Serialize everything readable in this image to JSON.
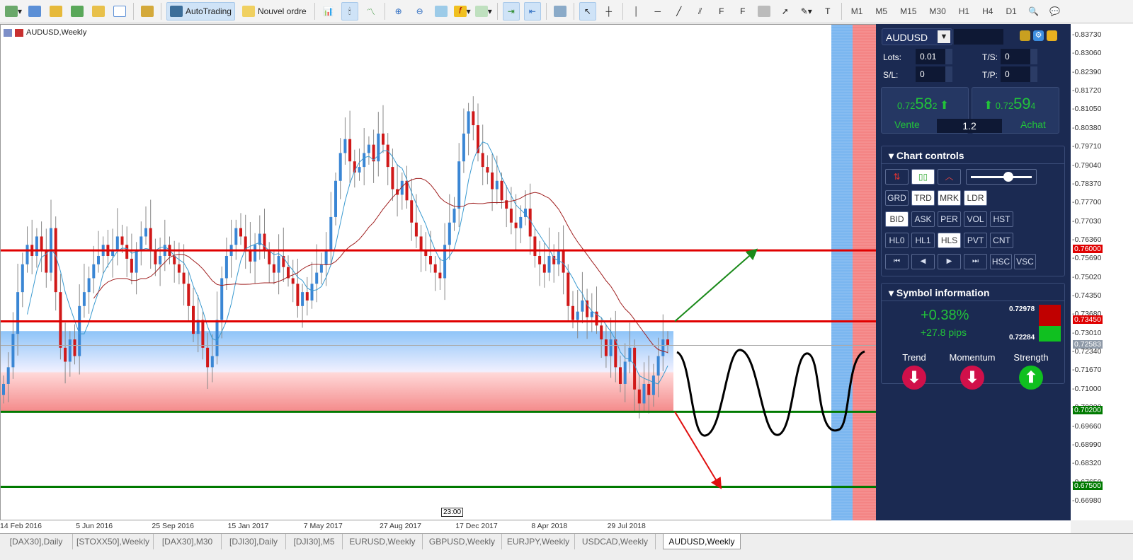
{
  "toolbar": {
    "autotrading": "AutoTrading",
    "new_order": "Nouvel ordre",
    "timeframes": [
      "M1",
      "M5",
      "M15",
      "M30",
      "H1",
      "H4",
      "D1"
    ]
  },
  "chart": {
    "title": "AUDUSD,Weekly",
    "time_marker": "23:00",
    "date_labels": [
      "14 Feb 2016",
      "5 Jun 2016",
      "25 Sep 2016",
      "15 Jan 2017",
      "7 May 2017",
      "27 Aug 2017",
      "17 Dec 2017",
      "8 Apr 2018",
      "29 Jul 2018"
    ],
    "price_ticks": [
      "0.83730",
      "0.83060",
      "0.82390",
      "0.81720",
      "0.81050",
      "0.80380",
      "0.79710",
      "0.79040",
      "0.78370",
      "0.77700",
      "0.77030",
      "0.76360",
      "0.75690",
      "0.75020",
      "0.74350",
      "0.73680",
      "0.73010",
      "0.72340",
      "0.71670",
      "0.71000",
      "0.70330",
      "0.69660",
      "0.68990",
      "0.68320",
      "0.67650",
      "0.66980"
    ],
    "levels": [
      {
        "price": "0.76000",
        "color": "#e00000"
      },
      {
        "price": "0.73450",
        "color": "#e00000"
      },
      {
        "price": "0.70200",
        "color": "#007a00"
      },
      {
        "price": "0.67500",
        "color": "#007a00"
      }
    ],
    "current_price": "0.72583",
    "weekly_closes": [
      0.712,
      0.718,
      0.73,
      0.745,
      0.755,
      0.762,
      0.758,
      0.765,
      0.76,
      0.752,
      0.768,
      0.745,
      0.725,
      0.72,
      0.728,
      0.722,
      0.74,
      0.745,
      0.75,
      0.755,
      0.758,
      0.762,
      0.758,
      0.76,
      0.765,
      0.762,
      0.757,
      0.752,
      0.76,
      0.765,
      0.768,
      0.76,
      0.755,
      0.758,
      0.762,
      0.758,
      0.755,
      0.752,
      0.748,
      0.74,
      0.73,
      0.735,
      0.725,
      0.718,
      0.722,
      0.735,
      0.75,
      0.758,
      0.762,
      0.768,
      0.765,
      0.76,
      0.756,
      0.762,
      0.766,
      0.76,
      0.755,
      0.752,
      0.758,
      0.754,
      0.75,
      0.748,
      0.74,
      0.745,
      0.742,
      0.748,
      0.752,
      0.755,
      0.76,
      0.772,
      0.785,
      0.795,
      0.8,
      0.792,
      0.788,
      0.79,
      0.795,
      0.798,
      0.792,
      0.802,
      0.798,
      0.79,
      0.782,
      0.78,
      0.785,
      0.778,
      0.77,
      0.765,
      0.76,
      0.758,
      0.755,
      0.752,
      0.75,
      0.762,
      0.77,
      0.775,
      0.792,
      0.802,
      0.81,
      0.805,
      0.795,
      0.79,
      0.788,
      0.782,
      0.785,
      0.778,
      0.775,
      0.77,
      0.768,
      0.772,
      0.775,
      0.765,
      0.758,
      0.755,
      0.752,
      0.758,
      0.755,
      0.76,
      0.752,
      0.74,
      0.735,
      0.738,
      0.742,
      0.736,
      0.738,
      0.733,
      0.728,
      0.722,
      0.728,
      0.718,
      0.712,
      0.72,
      0.725,
      0.71,
      0.705,
      0.712,
      0.708,
      0.715,
      0.722,
      0.728,
      0.726
    ],
    "colors": {
      "bull": "#3a86d4",
      "bear": "#d01818",
      "ma_fast": "#3a9ad0",
      "ma_slow": "#a02020"
    }
  },
  "panel": {
    "symbol": "AUDUSD",
    "lots_label": "Lots:",
    "lots": "0.01",
    "ts_label": "T/S:",
    "ts": "0",
    "sl_label": "S/L:",
    "sl": "0",
    "tp_label": "T/P:",
    "tp": "0",
    "sell": {
      "prefix": "0.72",
      "big": "58",
      "suffix": "2",
      "label": "Vente"
    },
    "buy": {
      "prefix": "0.72",
      "big": "59",
      "suffix": "4",
      "label": "Achat"
    },
    "spread": "1.2",
    "chart_controls": {
      "title": "Chart controls",
      "rows": [
        [
          "GRD",
          "TRD",
          "MRK",
          "LDR"
        ],
        [
          "BID",
          "ASK",
          "PER",
          "VOL",
          "HST"
        ],
        [
          "HL0",
          "HL1",
          "HLS",
          "PVT",
          "CNT"
        ]
      ],
      "active": [
        "TRD",
        "MRK",
        "LDR",
        "BID",
        "HLS"
      ],
      "nav": [
        "⏮",
        "◀",
        "▶",
        "⏭"
      ],
      "nav2": [
        "HSC",
        "VSC"
      ]
    },
    "symbol_info": {
      "title": "Symbol information",
      "change_pct": "+0.38%",
      "change_pips": "+27.8 pips",
      "high": "0.72978",
      "low": "0.72284",
      "indicators": [
        {
          "label": "Trend",
          "dir": "down"
        },
        {
          "label": "Momentum",
          "dir": "down"
        },
        {
          "label": "Strength",
          "dir": "up"
        }
      ]
    }
  },
  "tabs": [
    "[DAX30],Daily",
    "[STOXX50],Weekly",
    "[DAX30],M30",
    "[DJI30],Daily",
    "[DJI30],M5",
    "EURUSD,Weekly",
    "GBPUSD,Weekly",
    "EURJPY,Weekly",
    "USDCAD,Weekly",
    "AUDUSD,Weekly"
  ],
  "active_tab": "AUDUSD,Weekly"
}
